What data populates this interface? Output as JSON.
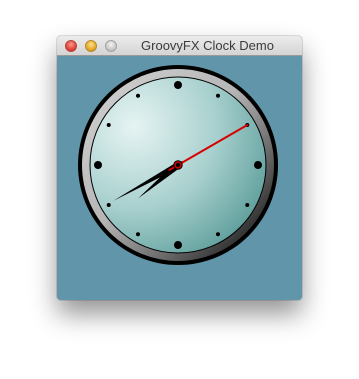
{
  "window": {
    "title": "GroovyFX Clock Demo",
    "controls": {
      "close": "close-button",
      "minimize": "minimize-button",
      "zoom": "zoom-button"
    }
  },
  "colors": {
    "background": "#6196aa",
    "bezel_outer": "#000000",
    "bezel_ring": "#b8b8b8",
    "face_light": "#e6f4f3",
    "face_dark": "#5f9f9c",
    "hands": "#000000",
    "second_hand": "#d60000"
  },
  "clock": {
    "hour": 7,
    "minute": 40,
    "second": 10
  }
}
